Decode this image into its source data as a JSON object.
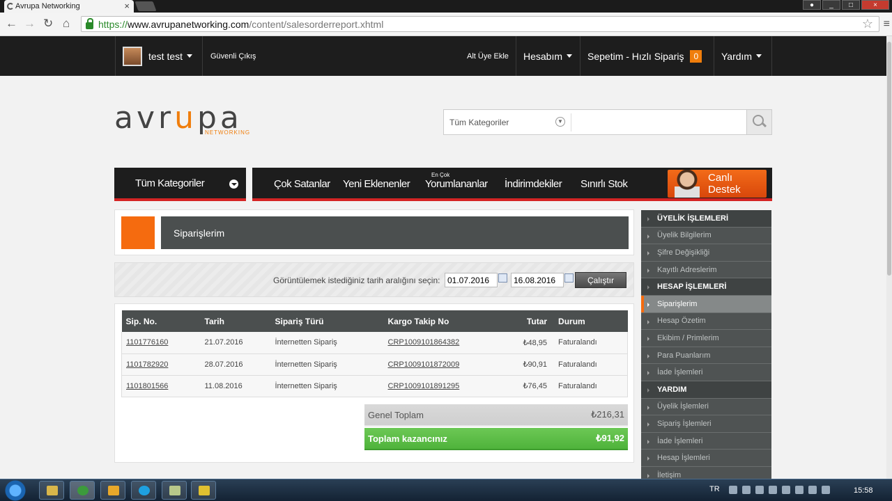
{
  "browser": {
    "tab_title": "Avrupa Networking",
    "url_scheme": "https://",
    "url_host": "www.avrupanetworking.com",
    "url_path": "/content/salesorderreport.xhtml"
  },
  "topbar": {
    "user": "test test",
    "logout": "Güvenli Çıkış",
    "add_sub_member": "Alt Üye Ekle",
    "account": "Hesabım",
    "cart": "Sepetim - Hızlı Sipariş",
    "cart_count": "0",
    "help": "Yardım"
  },
  "header": {
    "logo_text_dark": "avr",
    "logo_text_orange": "u",
    "logo_text_dark2": "pa",
    "logo_sub": "NETWORKING",
    "search_category": "Tüm Kategoriler",
    "search_placeholder": ""
  },
  "category_nav": {
    "all_categories": "Tüm Kategoriler",
    "links": [
      "Çok Satanlar",
      "Yeni Eklenenler",
      "Yorumlananlar",
      "İndirimdekiler",
      "Sınırlı Stok"
    ],
    "most_small": "En Çok",
    "live_support": "Canlı Destek"
  },
  "page": {
    "title": "Siparişlerim",
    "filter_label": "Görüntülemek istediğiniz tarih aralığını seçin:",
    "date_from": "01.07.2016",
    "date_to": "16.08.2016",
    "run_button": "Çalıştır"
  },
  "orders": {
    "columns": [
      "Sip. No.",
      "Tarih",
      "Sipariş Türü",
      "Kargo Takip No",
      "Tutar",
      "Durum"
    ],
    "rows": [
      {
        "no": "1101776160",
        "date": "21.07.2016",
        "type": "İnternetten Sipariş",
        "tracking": "CRP1009101864382",
        "amount": "₺48,95",
        "status": "Faturalandı"
      },
      {
        "no": "1101782920",
        "date": "28.07.2016",
        "type": "İnternetten Sipariş",
        "tracking": "CRP1009101872009",
        "amount": "₺90,91",
        "status": "Faturalandı"
      },
      {
        "no": "1101801566",
        "date": "11.08.2016",
        "type": "İnternetten Sipariş",
        "tracking": "CRP1009101891295",
        "amount": "₺76,45",
        "status": "Faturalandı"
      }
    ],
    "general_total_label": "Genel Toplam",
    "general_total_value": "₺216,31",
    "earnings_label": "Toplam kazancınız",
    "earnings_value": "₺91,92"
  },
  "sidebar": {
    "items": [
      {
        "label": "ÜYELİK İŞLEMLERİ",
        "kind": "header"
      },
      {
        "label": "Üyelik Bilgilerim",
        "kind": "item"
      },
      {
        "label": "Şifre Değişikliği",
        "kind": "item"
      },
      {
        "label": "Kayıtlı Adreslerim",
        "kind": "item"
      },
      {
        "label": "HESAP İŞLEMLERİ",
        "kind": "header"
      },
      {
        "label": "Siparişlerim",
        "kind": "active"
      },
      {
        "label": "Hesap Özetim",
        "kind": "item"
      },
      {
        "label": "Ekibim / Primlerim",
        "kind": "item"
      },
      {
        "label": "Para Puanlarım",
        "kind": "item"
      },
      {
        "label": "İade İşlemleri",
        "kind": "item"
      },
      {
        "label": "YARDIM",
        "kind": "header"
      },
      {
        "label": "Üyelik İşlemleri",
        "kind": "item"
      },
      {
        "label": "Sipariş İşlemleri",
        "kind": "item"
      },
      {
        "label": "İade İşlemleri",
        "kind": "item"
      },
      {
        "label": "Hesap İşlemleri",
        "kind": "item"
      },
      {
        "label": "İletişim",
        "kind": "item"
      }
    ]
  },
  "taskbar": {
    "language": "TR",
    "clock": "15:58"
  }
}
